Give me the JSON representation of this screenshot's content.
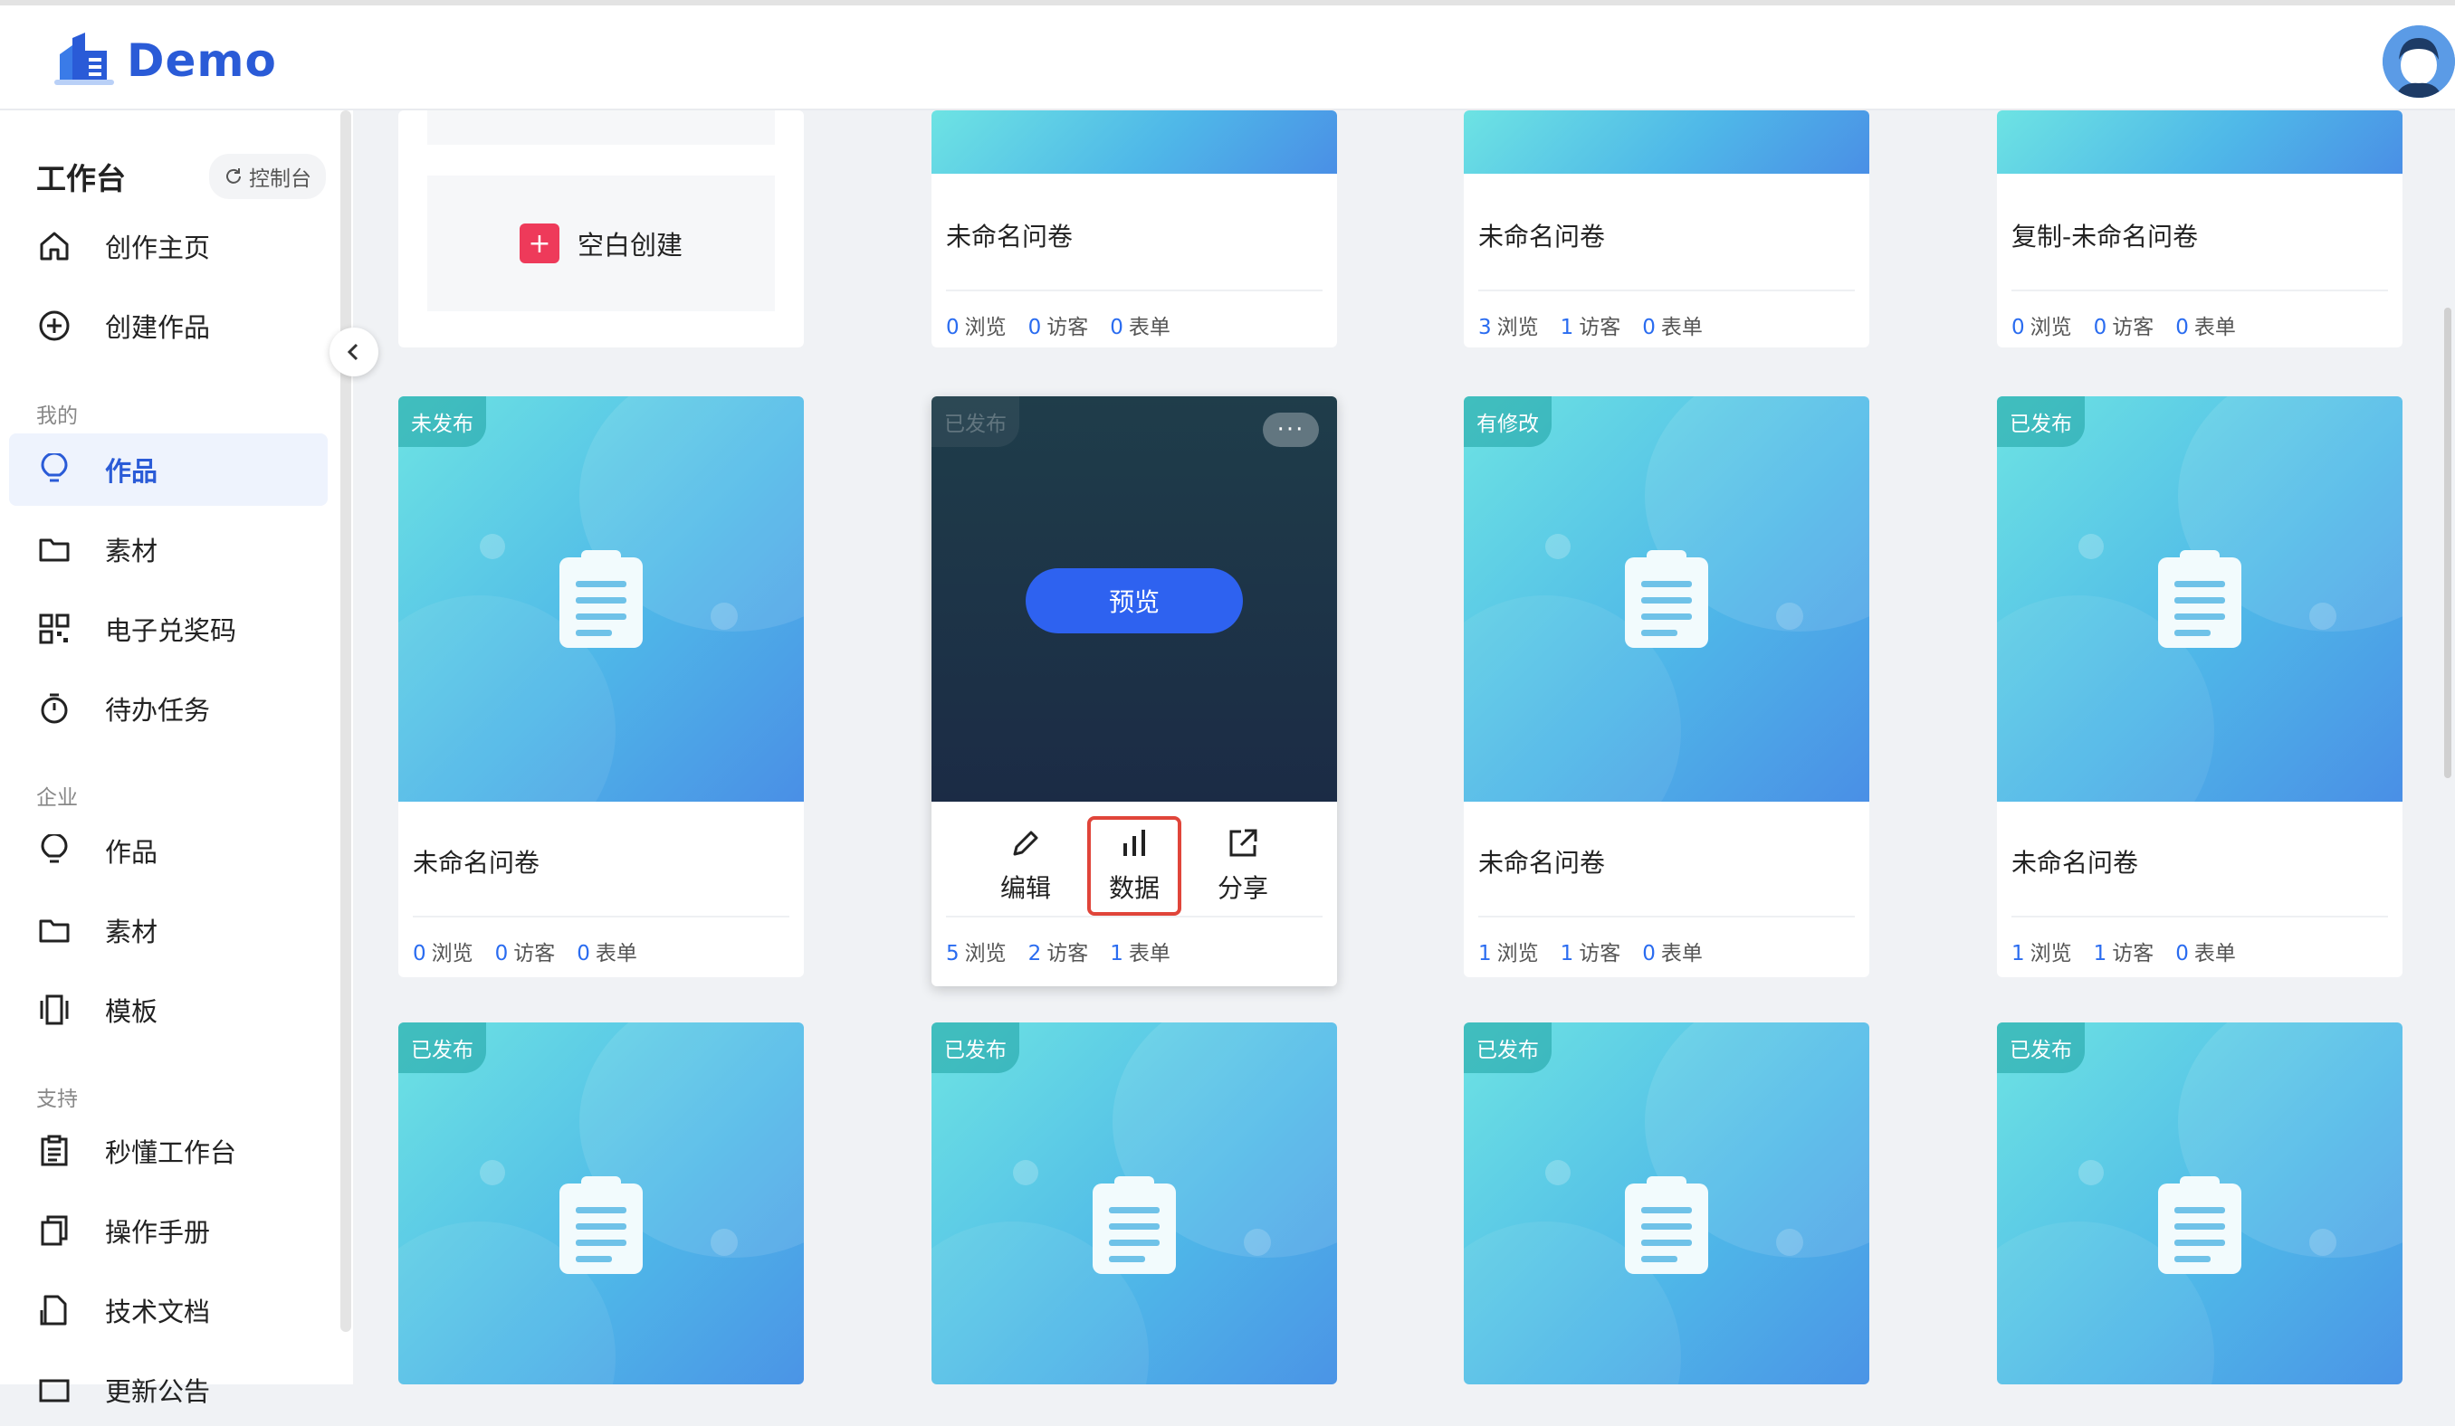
{
  "app": {
    "logo_text": "Demo"
  },
  "sidebar": {
    "workspace_title": "工作台",
    "console_button": "控制台",
    "items_top": [
      {
        "label": "创作主页",
        "icon": "home-icon"
      },
      {
        "label": "创建作品",
        "icon": "plus-circle-icon"
      }
    ],
    "section_mine": "我的",
    "items_mine": [
      {
        "label": "作品",
        "icon": "lightbulb-icon",
        "active": true
      },
      {
        "label": "素材",
        "icon": "folder-icon"
      },
      {
        "label": "电子兑奖码",
        "icon": "qrcode-icon"
      },
      {
        "label": "待办任务",
        "icon": "stopwatch-icon"
      }
    ],
    "section_enterprise": "企业",
    "items_enterprise": [
      {
        "label": "作品",
        "icon": "lightbulb-icon"
      },
      {
        "label": "素材",
        "icon": "folder-icon"
      },
      {
        "label": "模板",
        "icon": "template-icon"
      }
    ],
    "section_support": "支持",
    "items_support": [
      {
        "label": "秒懂工作台",
        "icon": "clipboard-icon"
      },
      {
        "label": "操作手册",
        "icon": "manual-icon"
      },
      {
        "label": "技术文档",
        "icon": "document-icon"
      },
      {
        "label": "更新公告",
        "icon": "announcement-icon"
      }
    ]
  },
  "main": {
    "blank_create_label": "空白创建",
    "stats_labels": {
      "views": "浏览",
      "visitors": "访客",
      "forms": "表单"
    },
    "row1": [
      {
        "title": "未命名问卷",
        "views": "0",
        "visitors": "0",
        "forms": "0"
      },
      {
        "title": "未命名问卷",
        "views": "3",
        "visitors": "1",
        "forms": "0"
      },
      {
        "title": "复制-未命名问卷",
        "views": "0",
        "visitors": "0",
        "forms": "0"
      }
    ],
    "row2": [
      {
        "badge": "未发布",
        "title": "未命名问卷",
        "views": "0",
        "visitors": "0",
        "forms": "0"
      },
      {
        "badge": "已发布",
        "preview_label": "预览",
        "more_label": "···",
        "actions": [
          {
            "label": "编辑",
            "icon": "edit-icon"
          },
          {
            "label": "数据",
            "icon": "bar-chart-icon"
          },
          {
            "label": "分享",
            "icon": "share-icon"
          }
        ],
        "views": "5",
        "visitors": "2",
        "forms": "1"
      },
      {
        "badge": "有修改",
        "title": "未命名问卷",
        "views": "1",
        "visitors": "1",
        "forms": "0"
      },
      {
        "badge": "已发布",
        "title": "未命名问卷",
        "views": "1",
        "visitors": "1",
        "forms": "0"
      }
    ],
    "row3": [
      {
        "badge": "已发布"
      },
      {
        "badge": "已发布"
      },
      {
        "badge": "已发布"
      },
      {
        "badge": "已发布"
      }
    ]
  }
}
